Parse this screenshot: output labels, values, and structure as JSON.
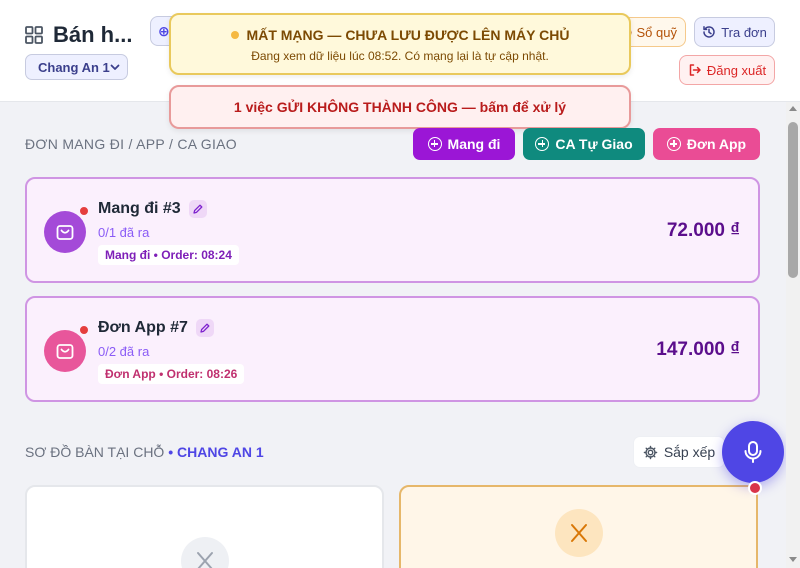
{
  "header": {
    "app_title": "Bán h...",
    "branch_selected": "Chang An 1",
    "buttons": {
      "so_quy": "Sổ quỹ",
      "tra_don": "Tra đơn",
      "dang_xuat": "Đăng xuất"
    }
  },
  "toasts": {
    "offline_title": "MẤT MẠNG — CHƯA LƯU ĐƯỢC LÊN MÁY CHỦ",
    "offline_message": "Đang xem dữ liệu lúc 08:52. Có mạng lại là tự cập nhật.",
    "error_message": "1 việc GỬI KHÔNG THÀNH CÔNG — bấm để xử lý"
  },
  "orders_section": {
    "title": "ĐƠN MANG ĐI / APP / CA GIAO",
    "buttons": {
      "mang_di": "Mang đi",
      "ca_tu_giao": "CA Tự Giao",
      "don_app": "Đơn App"
    },
    "orders": [
      {
        "name": "Mang đi #3",
        "progress": "0/1 đã ra",
        "meta": "Mang đi • Order: 08:24",
        "total": "72.000 ₫",
        "accent": "#9b16d6"
      },
      {
        "name": "Đơn App #7",
        "progress": "0/2 đã ra",
        "meta": "Đơn App • Order: 08:26",
        "total": "147.000 ₫",
        "accent": "#ea4c95"
      }
    ]
  },
  "tables_section": {
    "title": "SƠ ĐỒ BÀN TẠI CHỖ",
    "branch": "• CHANG AN 1",
    "sort_label": "Sắp xếp"
  },
  "colors": {
    "primary": "#4f46e5",
    "mang_di": "#9b16d6",
    "ca_tu_giao": "#0f8a7e",
    "don_app": "#ea4c95",
    "warning": "#e9c95c",
    "danger": "#dc2626"
  }
}
